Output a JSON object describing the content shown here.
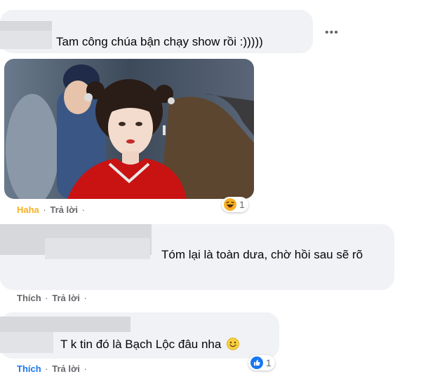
{
  "comments": [
    {
      "text": "Tam công chúa bận chạy show rồi :)))))",
      "more_label": "•••",
      "reaction_label": "Haha",
      "reply_label": "Trả lời",
      "dot": "·",
      "reaction_count": "1",
      "reaction_icon": "haha-emoji-icon"
    },
    {
      "text": "Tóm lại là toàn dưa, chờ hồi sau sẽ rõ",
      "reaction_label": "Thích",
      "reply_label": "Trả lời",
      "dot": "·"
    },
    {
      "text": "T k tin đó là Bạch Lộc đâu nha",
      "reaction_label": "Thích",
      "reply_label": "Trả lời",
      "dot": "·",
      "reaction_count": "1",
      "reaction_icon": "like-icon",
      "trailing_emoji": "smiling-emoji-icon"
    }
  ],
  "colors": {
    "bubble": "#f0f2f5",
    "haha": "#f7b125",
    "like": "#1877f2",
    "meta": "#65676b"
  }
}
